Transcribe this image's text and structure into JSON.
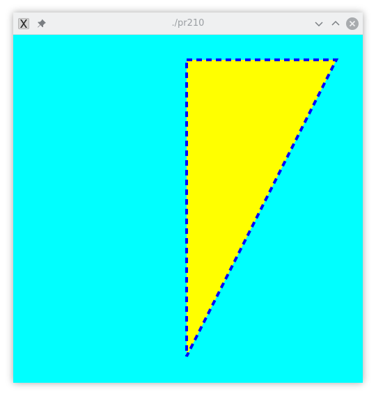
{
  "window": {
    "title": "./pr210"
  },
  "icons": {
    "app": "x11-app-icon",
    "pin": "pin-icon",
    "minimize": "chevron-down-icon",
    "maximize": "chevron-up-icon",
    "close": "close-icon"
  },
  "colors": {
    "background": "#00ffff",
    "fill": "#ffff00",
    "stroke": "#0000ff"
  }
}
